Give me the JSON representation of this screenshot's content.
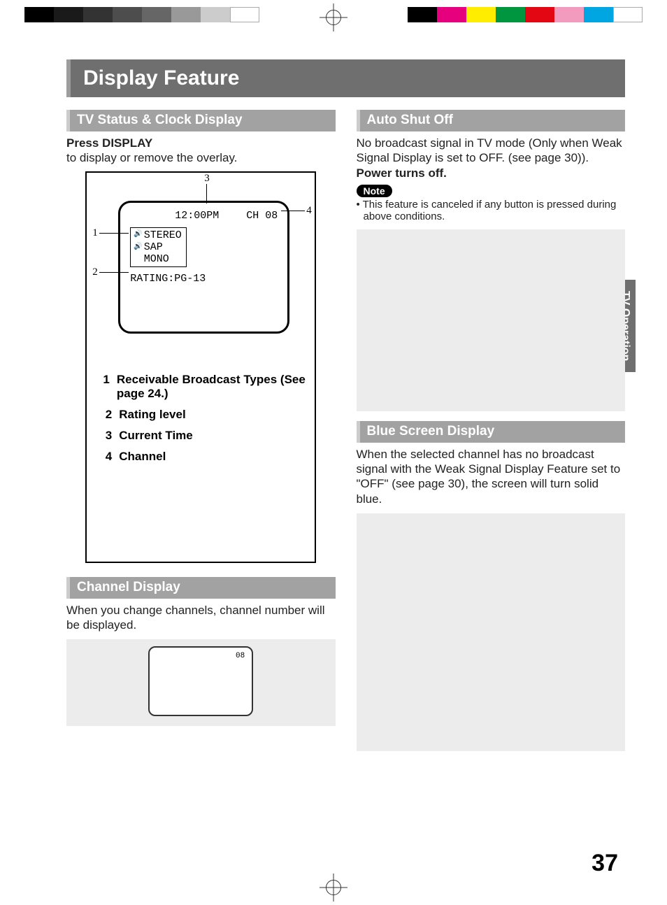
{
  "pageTitle": "Display Feature",
  "sideTab": "TV Operation",
  "pageNumber": "37",
  "left": {
    "sec1": {
      "heading": "TV Status & Clock Display",
      "line1": "Press DISPLAY",
      "line2": "to display or remove the overlay.",
      "osd": {
        "time": "12:00PM",
        "channel": "CH 08",
        "audio1": "STEREO",
        "audio2": "SAP",
        "audio3": "MONO",
        "rating": "RATING:PG-13"
      },
      "callouts": {
        "n1": "1",
        "n2": "2",
        "n3": "3",
        "n4": "4"
      },
      "legend": {
        "i1n": "1",
        "i1t": "Receivable Broadcast Types (See page 24.)",
        "i2n": "2",
        "i2t": "Rating level",
        "i3n": "3",
        "i3t": "Current Time",
        "i4n": "4",
        "i4t": "Channel"
      }
    },
    "sec2": {
      "heading": "Channel Display",
      "body": "When you change channels, channel number will be displayed.",
      "smallCh": "08"
    }
  },
  "right": {
    "sec1": {
      "heading": "Auto Shut Off",
      "body1": "No broadcast signal in TV mode (Only when Weak Signal Display is set to OFF. (see page 30)).",
      "body2": "Power turns off.",
      "noteLabel": "Note",
      "noteText": "• This feature is canceled if any button is pressed during above conditions."
    },
    "sec2": {
      "heading": "Blue Screen Display",
      "body": "When the selected channel has no broadcast signal with the Weak Signal Display Feature set to \"OFF\" (see page 30), the screen will turn solid blue."
    }
  }
}
